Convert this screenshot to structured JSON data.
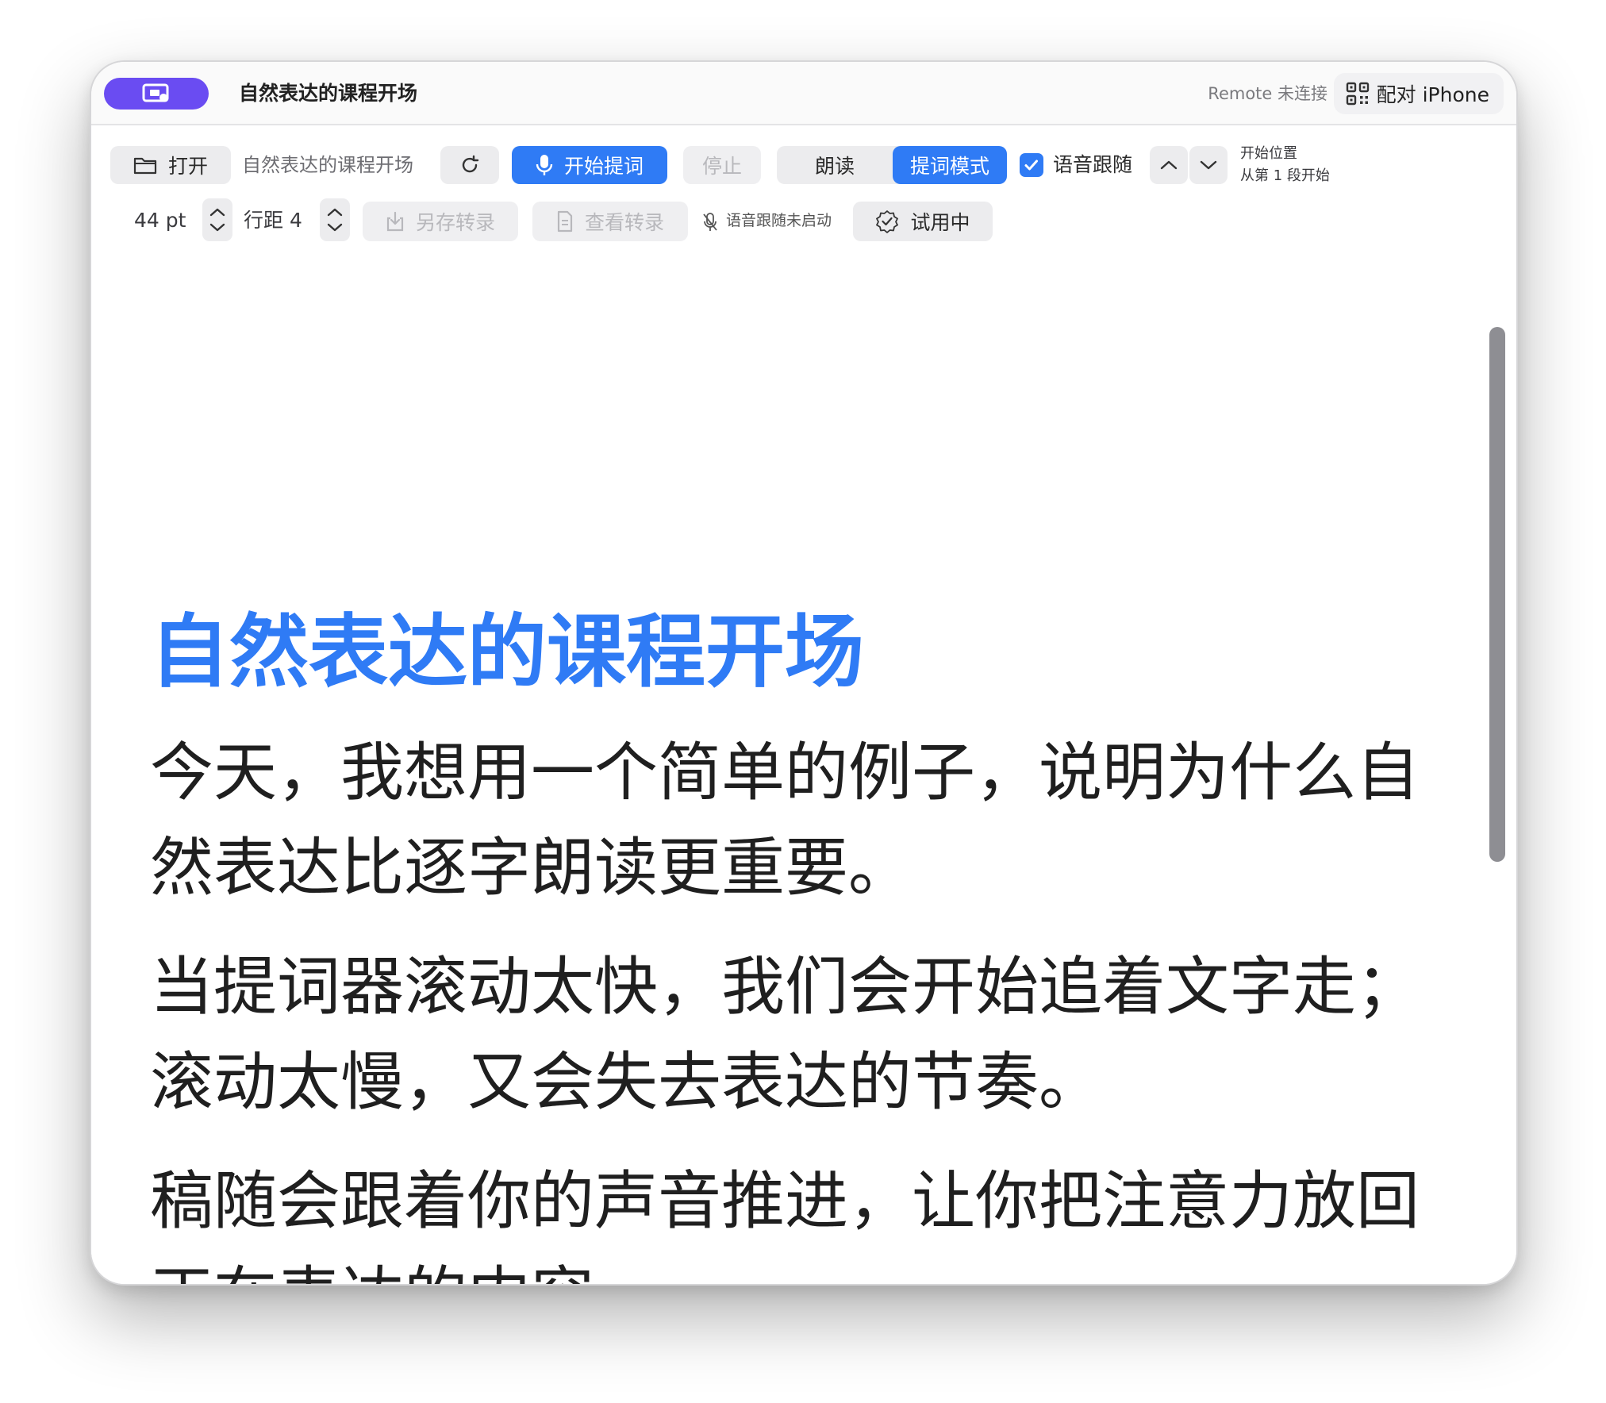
{
  "window": {
    "title": "自然表达的课程开场",
    "remote_status": "Remote 未连接",
    "pair_label": "配对 iPhone"
  },
  "toolbar": {
    "open_label": "打开",
    "file_name": "自然表达的课程开场",
    "start_label": "开始提词",
    "stop_label": "停止",
    "mode_read": "朗读",
    "mode_prompter": "提词模式",
    "voice_follow_label": "语音跟随",
    "voice_follow_checked": true,
    "start_position_title": "开始位置",
    "start_position_value": "从第 1 段开始",
    "font_size": "44 pt",
    "line_spacing": "行距 4",
    "save_transcript": "另存转录",
    "view_transcript": "查看转录",
    "voice_status": "语音跟随未启动",
    "trial_label": "试用中"
  },
  "script": {
    "title": "自然表达的课程开场",
    "paragraphs": [
      "今天，我想用一个简单的例子，说明为什么自然表达比逐字朗读更重要。",
      "当提词器滚动太快，我们会开始追着文字走；滚动太慢，又会失去表达的节奏。",
      "稿随会跟着你的声音推进，让你把注意力放回正在表达的内容。"
    ]
  },
  "colors": {
    "accent": "#2f7bf5",
    "app_pill": "#6a4cf2"
  },
  "icons": [
    "app-logo-icon",
    "qr-code-icon",
    "folder-icon",
    "reload-icon",
    "mic-icon",
    "checkmark-icon",
    "chevron-up-icon",
    "chevron-down-icon",
    "download-icon",
    "document-icon",
    "mic-off-icon",
    "badge-check-icon"
  ]
}
